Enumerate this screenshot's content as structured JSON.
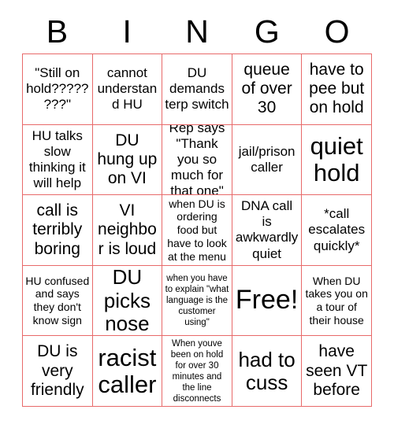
{
  "card": {
    "title_letters": [
      "B",
      "I",
      "N",
      "G",
      "O"
    ],
    "border_color": "#e86a6a",
    "text_color": "#000000",
    "background_color": "#ffffff",
    "columns": 5,
    "rows": 5
  },
  "cells": [
    {
      "text": "\"Still on hold????????\"",
      "size": "m"
    },
    {
      "text": "cannot understand HU",
      "size": "m"
    },
    {
      "text": "DU demands terp switch",
      "size": "m"
    },
    {
      "text": "queue of over 30",
      "size": "l"
    },
    {
      "text": "have to pee but on hold",
      "size": "l"
    },
    {
      "text": "HU talks slow thinking it will help",
      "size": "m"
    },
    {
      "text": "DU hung up on VI",
      "size": "l"
    },
    {
      "text": "Rep says \"Thank you so much for that one\"",
      "size": "m"
    },
    {
      "text": "jail/prison caller",
      "size": "m"
    },
    {
      "text": "quiet hold",
      "size": "xxl"
    },
    {
      "text": "call is terribly boring",
      "size": "l"
    },
    {
      "text": "VI neighbor is loud",
      "size": "l"
    },
    {
      "text": "when DU is ordering food but have to look at the menu",
      "size": "s"
    },
    {
      "text": "DNA call is awkwardly quiet",
      "size": "m"
    },
    {
      "text": "*call escalates quickly*",
      "size": "m"
    },
    {
      "text": "HU confused and says they don't know sign",
      "size": "s"
    },
    {
      "text": "DU picks nose",
      "size": "xl"
    },
    {
      "text": "when you have to explain \"what language is the customer using\"",
      "size": "xs"
    },
    {
      "text": "Free!",
      "size": "free"
    },
    {
      "text": "When DU takes you on a tour of their house",
      "size": "s"
    },
    {
      "text": "DU is very friendly",
      "size": "l"
    },
    {
      "text": "racist caller",
      "size": "xxl"
    },
    {
      "text": "When youve been on hold for over 30 minutes and the line disconnects",
      "size": "xs"
    },
    {
      "text": "had to cuss",
      "size": "xl"
    },
    {
      "text": "have seen VT before",
      "size": "l"
    }
  ]
}
